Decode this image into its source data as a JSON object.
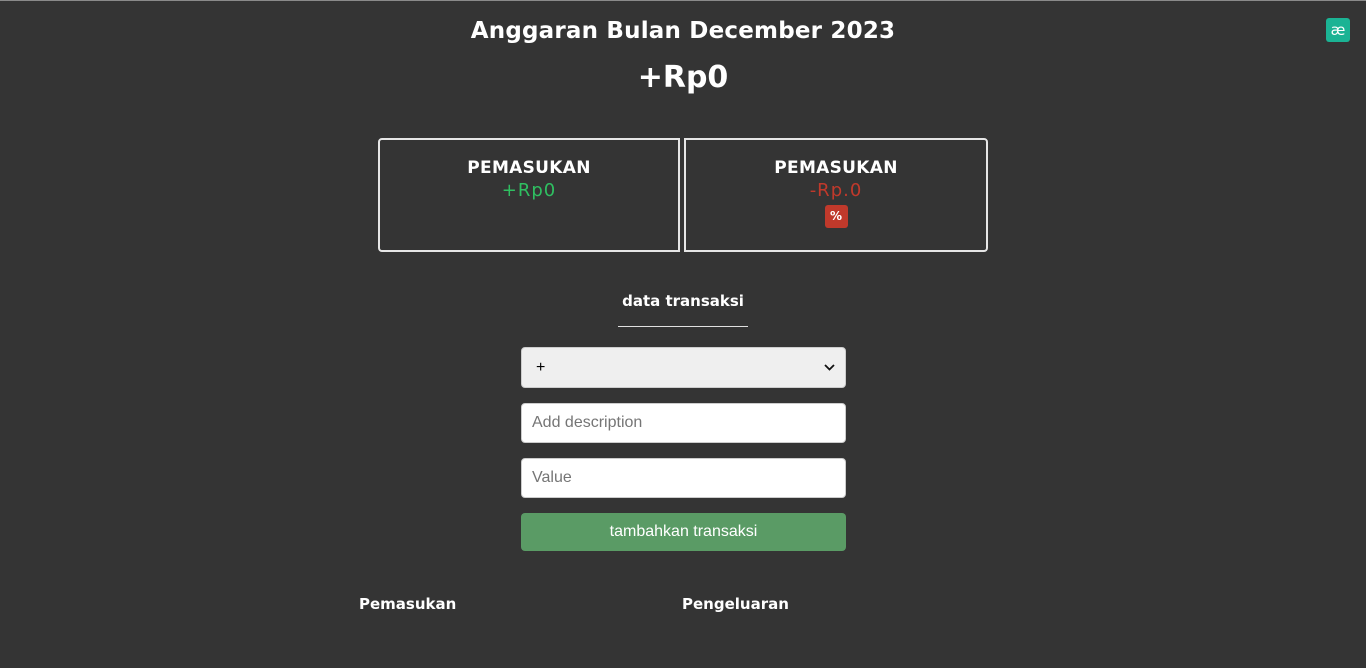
{
  "header": {
    "title": "Anggaran Bulan December 2023",
    "balance": "+Rp0",
    "logo_text": "æ"
  },
  "summary": {
    "income": {
      "label": "PEMASUKAN",
      "value": "+Rp0"
    },
    "expense": {
      "label": "PEMASUKAN",
      "value": "-Rp.0",
      "percent_badge": "%"
    }
  },
  "form": {
    "section_title": "data transaksi",
    "type_select": {
      "selected": "+",
      "icon": "chevron-down-icon"
    },
    "description": {
      "placeholder": "Add description",
      "value": ""
    },
    "value": {
      "placeholder": "Value",
      "value": ""
    },
    "submit_label": "tambahkan transaksi"
  },
  "lists": {
    "income_heading": "Pemasukan",
    "expense_heading": "Pengeluaran"
  },
  "colors": {
    "background": "#343434",
    "income": "#2fbf61",
    "expense": "#c0392b",
    "button": "#5a9b65",
    "logo": "#1bb394"
  }
}
